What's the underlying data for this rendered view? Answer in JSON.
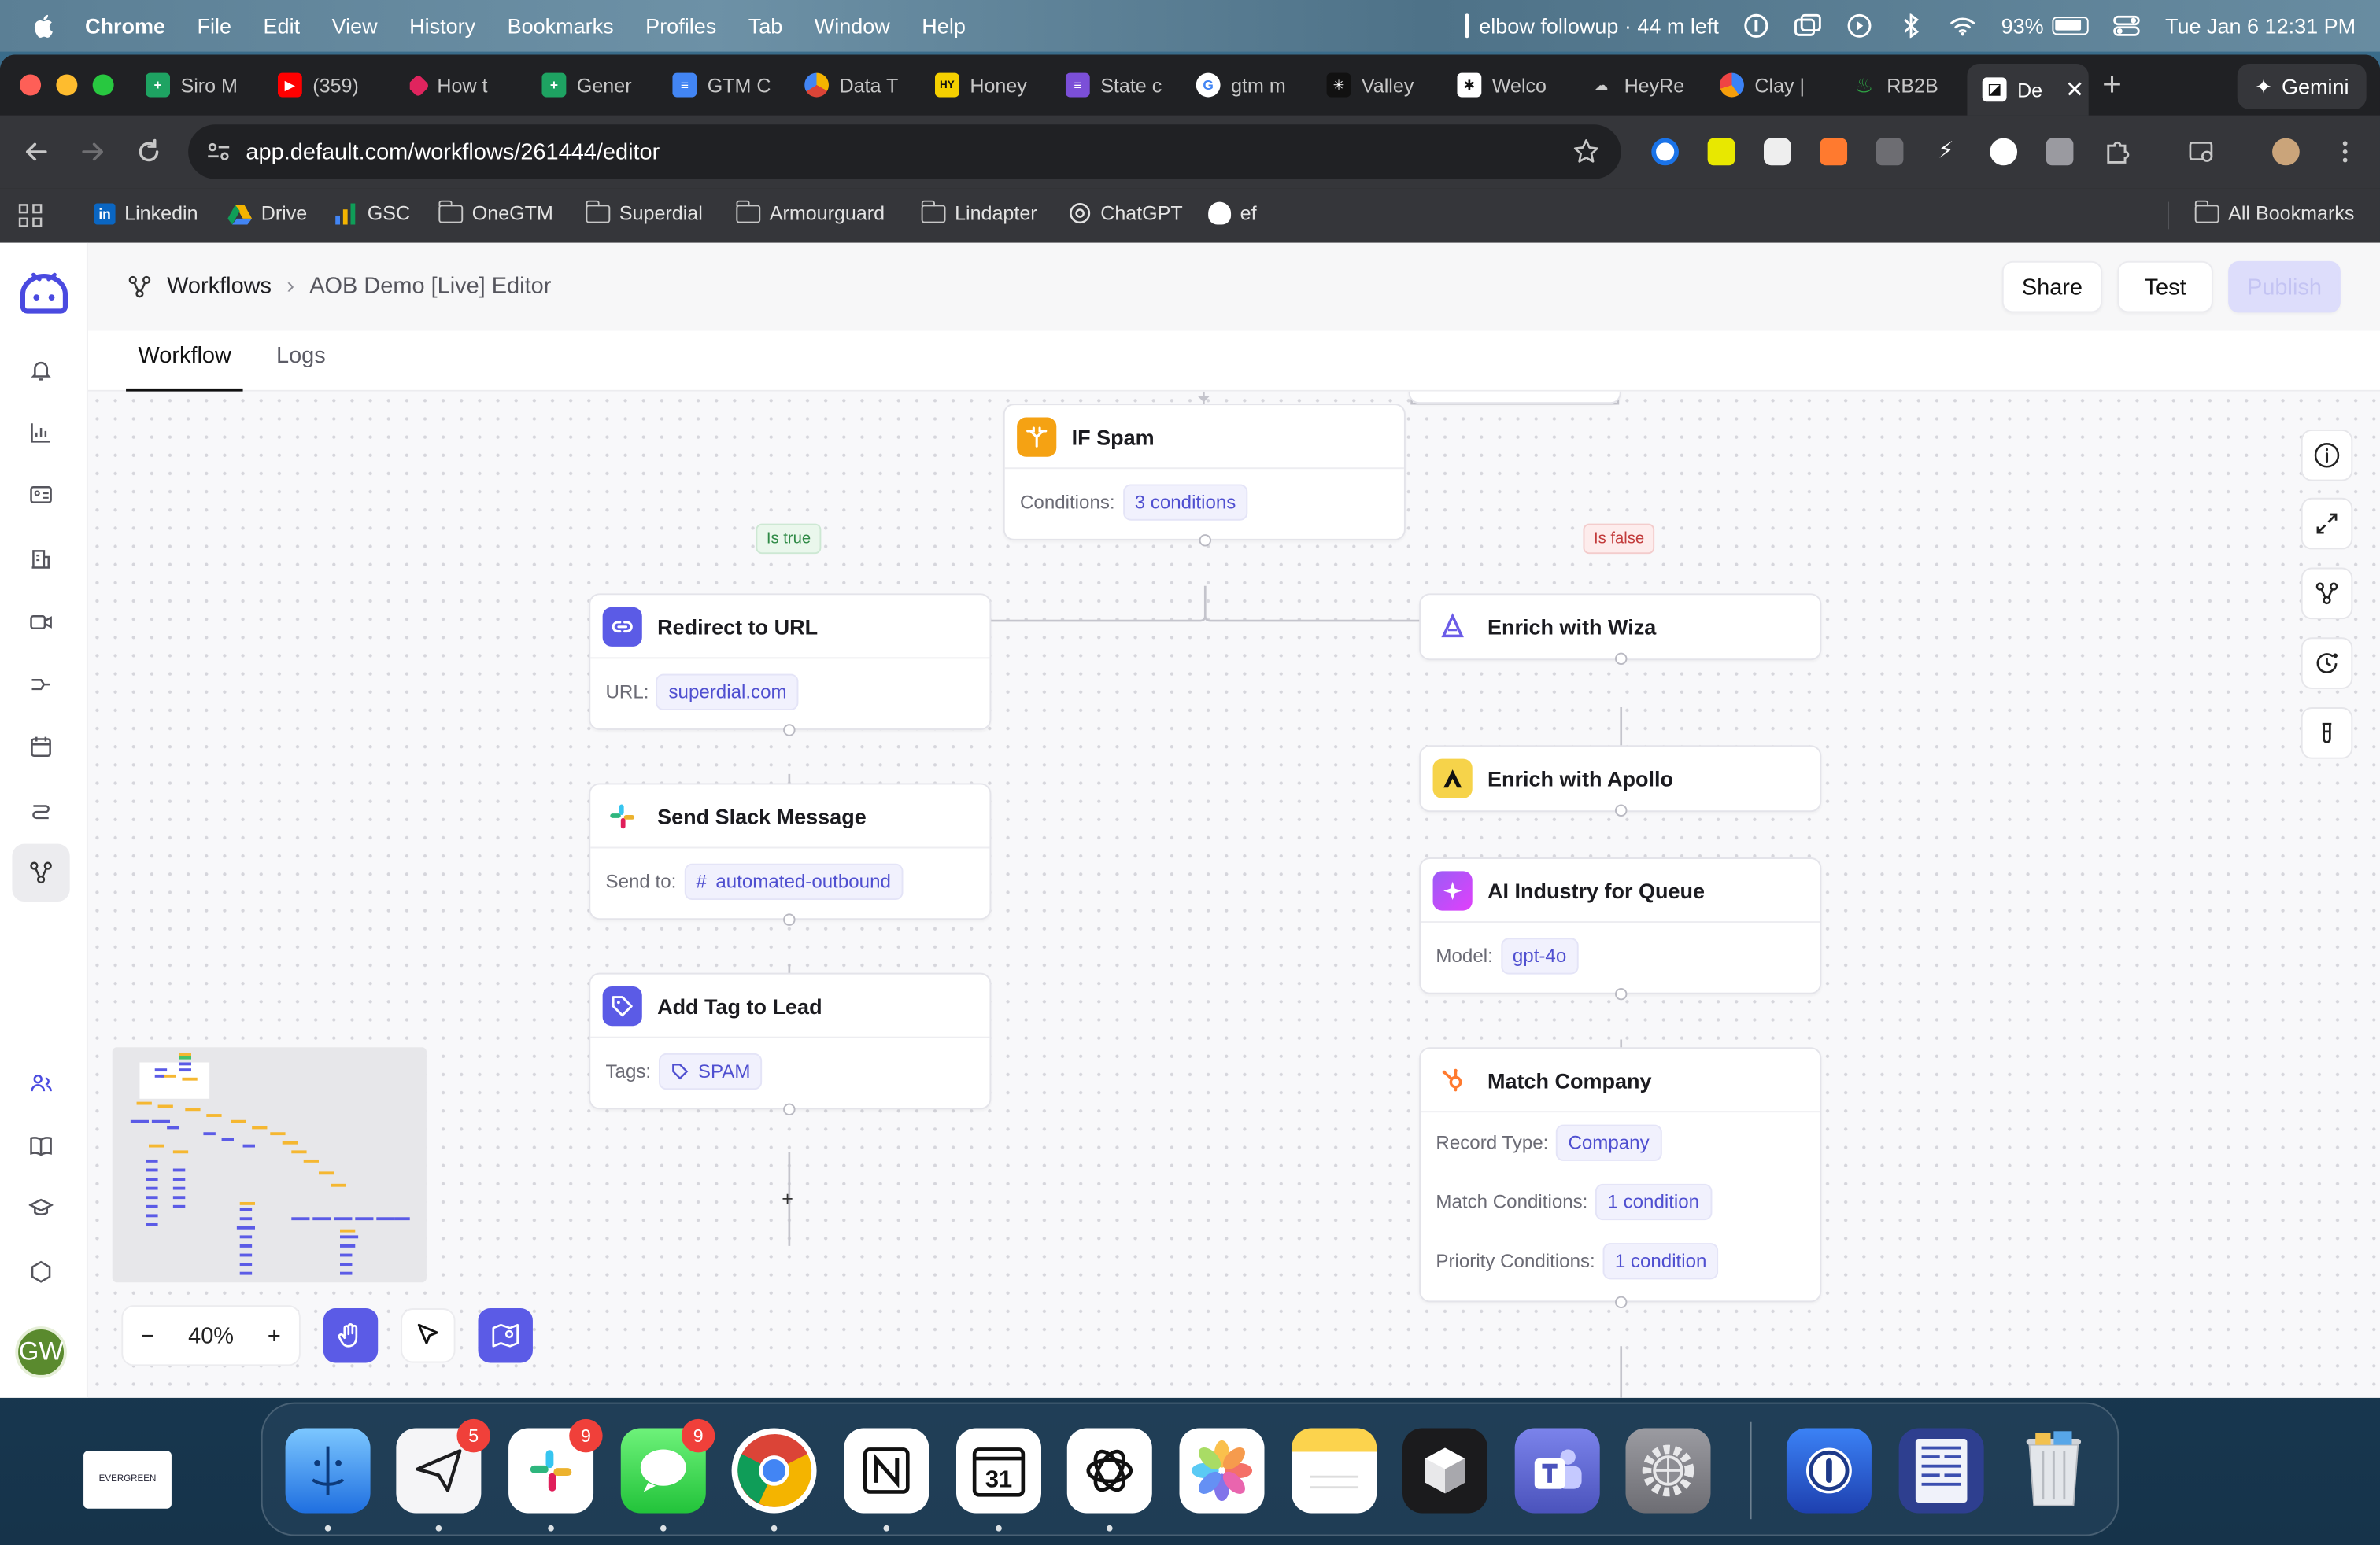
{
  "menubar": {
    "app": "Chrome",
    "items": [
      "File",
      "Edit",
      "View",
      "History",
      "Bookmarks",
      "Profiles",
      "Tab",
      "Window",
      "Help"
    ],
    "reminder": "elbow followup · 44 m left",
    "battery": "93%",
    "datetime": "Tue Jan 6  12:31 PM"
  },
  "tabs": [
    {
      "label": "Siro M",
      "color": "#1ea362"
    },
    {
      "label": "(359)",
      "color": "#ff0000"
    },
    {
      "label": "How t",
      "color": "#e0245e"
    },
    {
      "label": "Gener",
      "color": "#1ea362"
    },
    {
      "label": "GTM C",
      "color": "#4285f4"
    },
    {
      "label": "Data T",
      "color": "#f4b400"
    },
    {
      "label": "Honey",
      "color": "#f5d000"
    },
    {
      "label": "State c",
      "color": "#7b4fd8"
    },
    {
      "label": "gtm m",
      "color": "#ffffff"
    },
    {
      "label": "Valley",
      "color": "#111111"
    },
    {
      "label": "Welco",
      "color": "#111111"
    },
    {
      "label": "HeyRe",
      "color": "#6b6b6b"
    },
    {
      "label": "Clay |",
      "color": "#3b82f6"
    },
    {
      "label": "RB2B",
      "color": "#2ea043"
    },
    {
      "label": "De",
      "color": "#ffffff"
    }
  ],
  "gemini_label": "Gemini",
  "address": "app.default.com/workflows/261444/editor",
  "bookmarks": [
    {
      "label": "Linkedin",
      "type": "linkedin"
    },
    {
      "label": "Drive",
      "type": "drive"
    },
    {
      "label": "GSC",
      "type": "gsc"
    },
    {
      "label": "OneGTM",
      "type": "folder"
    },
    {
      "label": "Superdial",
      "type": "folder"
    },
    {
      "label": "Armourguard",
      "type": "folder"
    },
    {
      "label": "Lindapter",
      "type": "folder"
    },
    {
      "label": "ChatGPT",
      "type": "chatgpt"
    },
    {
      "label": "ef",
      "type": "ghost"
    }
  ],
  "all_bookmarks": "All Bookmarks",
  "breadcrumb": {
    "root": "Workflows",
    "current": "AOB Demo [Live] Editor"
  },
  "actions": {
    "share": "Share",
    "test": "Test",
    "publish": "Publish"
  },
  "page_tabs": {
    "workflow": "Workflow",
    "logs": "Logs"
  },
  "branch": {
    "true_label": "Is true",
    "false_label": "Is false"
  },
  "nodes": {
    "if_spam": {
      "title": "IF Spam",
      "label": "Conditions:",
      "value": "3 conditions"
    },
    "redirect": {
      "title": "Redirect to URL",
      "label": "URL:",
      "value": "superdial.com"
    },
    "slack": {
      "title": "Send Slack Message",
      "label": "Send to:",
      "value": "automated-outbound"
    },
    "tag": {
      "title": "Add Tag to Lead",
      "label": "Tags:",
      "value": "SPAM"
    },
    "wiza": {
      "title": "Enrich with Wiza"
    },
    "apollo": {
      "title": "Enrich with Apollo"
    },
    "ai": {
      "title": "AI Industry for Queue",
      "label": "Model:",
      "value": "gpt-4o"
    },
    "match": {
      "title": "Match Company",
      "record_label": "Record Type:",
      "record_value": "Company",
      "match_label": "Match Conditions:",
      "match_value": "1 condition",
      "priority_label": "Priority Conditions:",
      "priority_value": "1 condition"
    }
  },
  "add_step": "+",
  "zoom": {
    "minus": "−",
    "value": "40%",
    "plus": "+"
  },
  "avatar_initials": "GW",
  "dock_badges": {
    "spark": "5",
    "slack": "9",
    "messages": "9"
  },
  "dock_calendar_day": "31",
  "dock_thumb": "EVERGREEN",
  "colors": {
    "accent": "#5b5be6",
    "publish_disabled": "#ddddfb",
    "true": "#2f8a46",
    "false": "#c23a3a"
  }
}
